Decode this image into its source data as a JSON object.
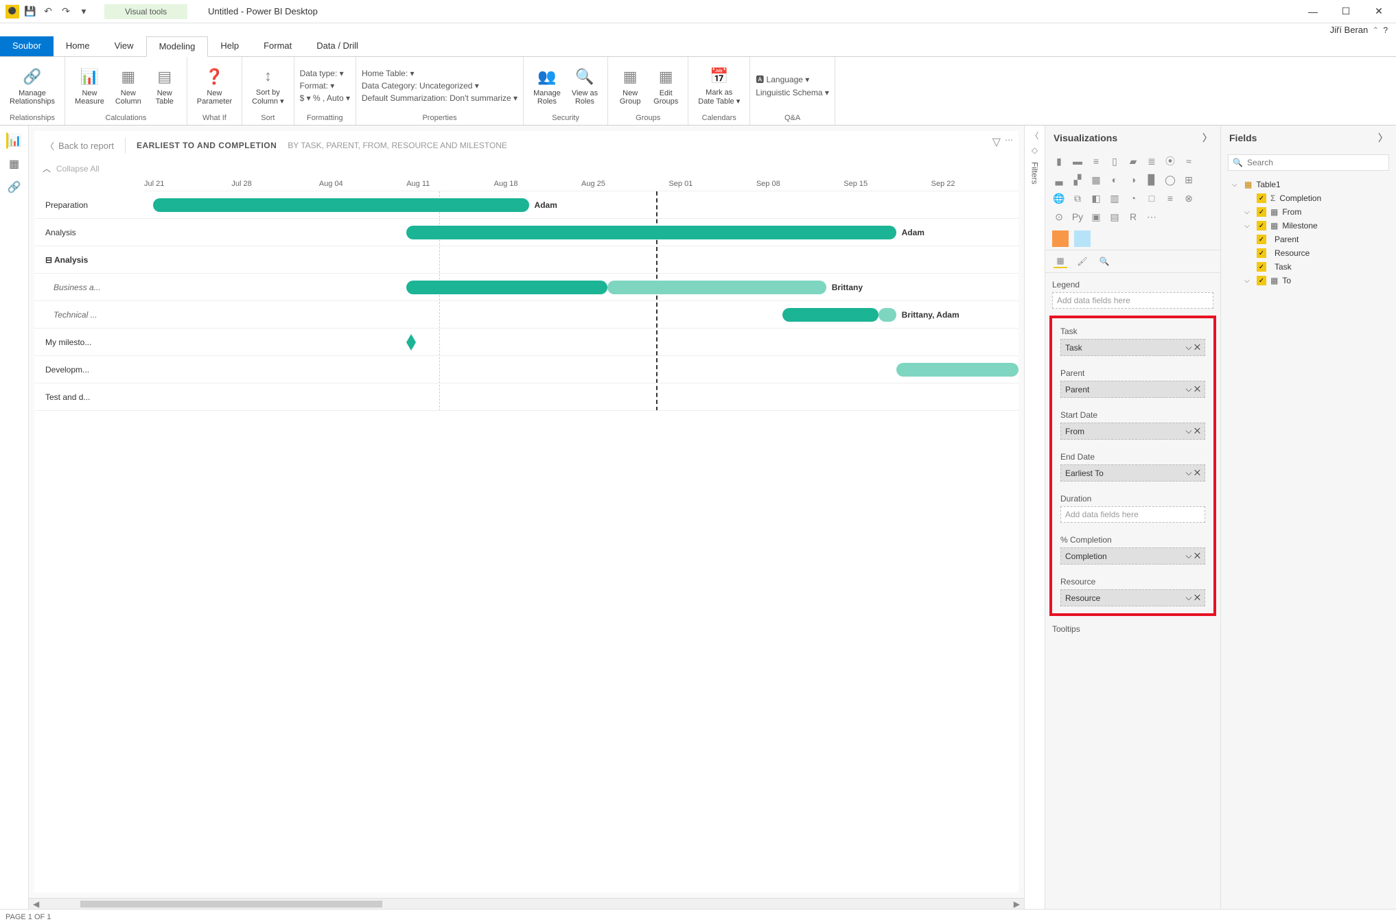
{
  "titlebar": {
    "tools_tab": "Visual tools",
    "title": "Untitled - Power BI Desktop",
    "user": "Jiří Beran"
  },
  "ribbon_tabs": {
    "file": "Soubor",
    "home": "Home",
    "view": "View",
    "modeling": "Modeling",
    "help": "Help",
    "format": "Format",
    "data_drill": "Data / Drill"
  },
  "ribbon": {
    "relationships": {
      "manage": "Manage\nRelationships",
      "label": "Relationships"
    },
    "calculations": {
      "measure": "New\nMeasure",
      "column": "New\nColumn",
      "table": "New\nTable",
      "label": "Calculations"
    },
    "whatif": {
      "param": "New\nParameter",
      "label": "What If"
    },
    "sort": {
      "sort": "Sort by\nColumn ▾",
      "label": "Sort"
    },
    "formatting": {
      "datatype": "Data type: ▾",
      "format": "Format: ▾",
      "currency": "$ ▾ % , Auto ▾",
      "label": "Formatting"
    },
    "properties": {
      "home_table": "Home Table: ▾",
      "category": "Data Category: Uncategorized ▾",
      "summarization": "Default Summarization: Don't summarize ▾",
      "label": "Properties"
    },
    "security": {
      "manage": "Manage\nRoles",
      "viewas": "View as\nRoles",
      "label": "Security"
    },
    "groups": {
      "new": "New\nGroup",
      "edit": "Edit\nGroups",
      "label": "Groups"
    },
    "calendars": {
      "mark": "Mark as\nDate Table ▾",
      "label": "Calendars"
    },
    "qna": {
      "language": "🅰 Language ▾",
      "schema": "Linguistic Schema ▾",
      "label": "Q&A"
    }
  },
  "canvas": {
    "back": "Back to report",
    "title": "EARLIEST TO AND COMPLETION",
    "subtitle": "BY TASK, PARENT, FROM, RESOURCE AND MILESTONE",
    "collapse": "Collapse All",
    "dates": [
      "Jul 21",
      "Jul 28",
      "Aug 04",
      "Aug 11",
      "Aug 18",
      "Aug 25",
      "Sep 01",
      "Sep 08",
      "Sep 15",
      "Sep 22"
    ],
    "tasks": [
      {
        "label": "Preparation",
        "style": "",
        "bars": [
          {
            "start": 1,
            "end": 44,
            "color": "#1BB495",
            "res": "Adam"
          }
        ]
      },
      {
        "label": "Analysis",
        "style": "",
        "bars": [
          {
            "start": 30,
            "end": 86,
            "color": "#1BB495",
            "res": "Adam"
          }
        ]
      },
      {
        "label": "Analysis",
        "style": "bold"
      },
      {
        "label": "Business a...",
        "style": "italic",
        "bars": [
          {
            "start": 30,
            "end": 53,
            "color": "#1BB495"
          },
          {
            "start": 53,
            "end": 78,
            "color": "#7ED6C1",
            "res": "Brittany"
          }
        ]
      },
      {
        "label": "Technical ...",
        "style": "italic",
        "bars": [
          {
            "start": 73,
            "end": 84,
            "color": "#1BB495"
          },
          {
            "start": 84,
            "end": 86,
            "color": "#7ED6C1",
            "res": "Brittany, Adam"
          }
        ]
      },
      {
        "label": "My milesto...",
        "style": "",
        "milestone": 30
      },
      {
        "label": "Developm...",
        "style": "",
        "bars": [
          {
            "start": 86,
            "end": 100,
            "color": "#7ED6C1"
          }
        ]
      },
      {
        "label": "Test and d...",
        "style": ""
      }
    ]
  },
  "filter_label": "Filters",
  "viz": {
    "header": "Visualizations",
    "legend": "Legend",
    "add_placeholder": "Add data fields here",
    "buckets": [
      {
        "label": "Task",
        "value": "Task"
      },
      {
        "label": "Parent",
        "value": "Parent"
      },
      {
        "label": "Start Date",
        "value": "From"
      },
      {
        "label": "End Date",
        "value": "Earliest To"
      },
      {
        "label": "Duration",
        "value": ""
      },
      {
        "label": "% Completion",
        "value": "Completion"
      },
      {
        "label": "Resource",
        "value": "Resource"
      }
    ],
    "tooltips": "Tooltips"
  },
  "fields": {
    "header": "Fields",
    "search_placeholder": "Search",
    "table": "Table1",
    "items": [
      {
        "name": "Completion",
        "icon": "Σ",
        "checked": true,
        "expand": ""
      },
      {
        "name": "From",
        "icon": "▦",
        "checked": true,
        "expand": "⌵"
      },
      {
        "name": "Milestone",
        "icon": "▦",
        "checked": true,
        "expand": "⌵"
      },
      {
        "name": "Parent",
        "icon": "",
        "checked": true,
        "expand": ""
      },
      {
        "name": "Resource",
        "icon": "",
        "checked": true,
        "expand": ""
      },
      {
        "name": "Task",
        "icon": "",
        "checked": true,
        "expand": ""
      },
      {
        "name": "To",
        "icon": "▦",
        "checked": true,
        "expand": "⌵"
      }
    ]
  },
  "status": "PAGE 1 OF 1",
  "chart_data": {
    "type": "bar",
    "title": "EARLIEST TO AND COMPLETION",
    "subtitle_fields": "BY TASK, PARENT, FROM, RESOURCE AND MILESTONE",
    "x_axis": {
      "type": "date",
      "start": "Jul 21",
      "end": "Sep 22",
      "ticks": [
        "Jul 21",
        "Jul 28",
        "Aug 04",
        "Aug 11",
        "Aug 18",
        "Aug 25",
        "Sep 01",
        "Sep 08",
        "Sep 15",
        "Sep 22"
      ]
    },
    "today_line_approx": "Aug 25",
    "rows": [
      {
        "task": "Preparation",
        "bars": [
          {
            "from": "Jul 22",
            "to": "Aug 20",
            "completion": 1.0,
            "resource": "Adam"
          }
        ]
      },
      {
        "task": "Analysis",
        "bars": [
          {
            "from": "Aug 10",
            "to": "Sep 13",
            "completion": 1.0,
            "resource": "Adam"
          }
        ]
      },
      {
        "task": "Analysis",
        "group_header": true
      },
      {
        "task": "Business a...",
        "parent": "Analysis",
        "bars": [
          {
            "from": "Aug 10",
            "to": "Sep 06",
            "completion": 0.48,
            "resource": "Brittany"
          }
        ]
      },
      {
        "task": "Technical ...",
        "parent": "Analysis",
        "bars": [
          {
            "from": "Sep 03",
            "to": "Sep 13",
            "completion": 0.85,
            "resource": "Brittany, Adam"
          }
        ]
      },
      {
        "task": "My milesto...",
        "milestone": "Aug 10"
      },
      {
        "task": "Developm...",
        "bars": [
          {
            "from": "Sep 13",
            "to": "Sep 27",
            "completion": 0.0
          }
        ]
      },
      {
        "task": "Test and d..."
      }
    ]
  }
}
